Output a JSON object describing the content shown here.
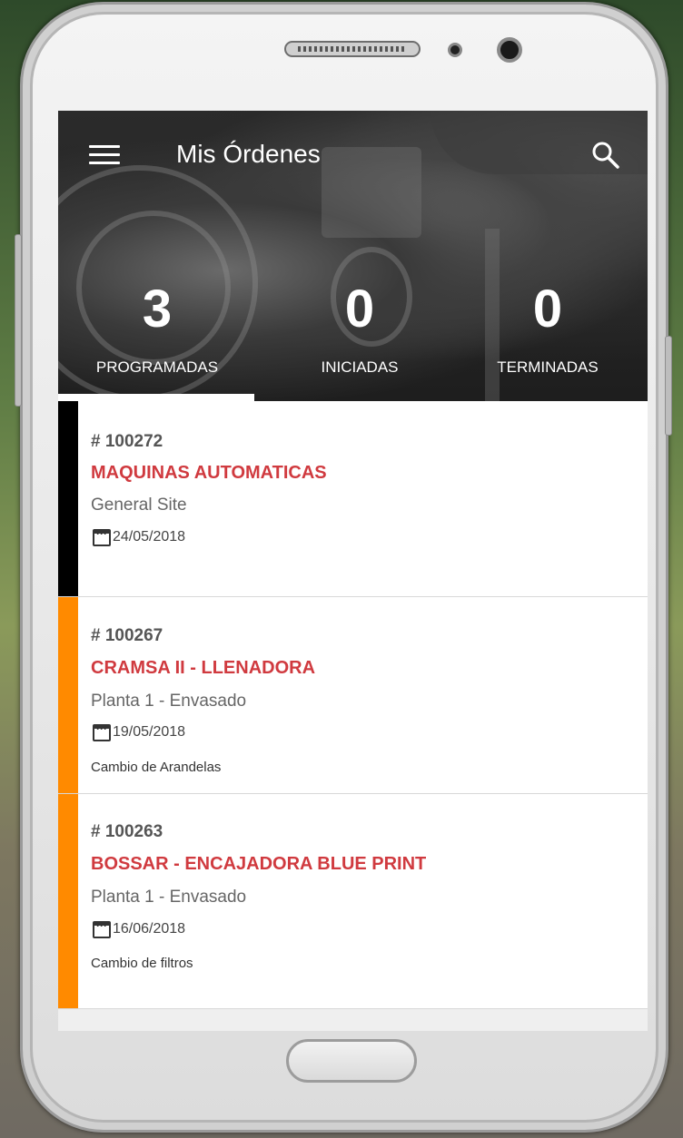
{
  "app": {
    "title": "Mis Órdenes"
  },
  "stats": [
    {
      "count": "3",
      "label": "PROGRAMADAS"
    },
    {
      "count": "0",
      "label": "INICIADAS"
    },
    {
      "count": "0",
      "label": "TERMINADAS"
    }
  ],
  "orders": [
    {
      "number": "# 100272",
      "name": "MAQUINAS AUTOMATICAS",
      "site": "General Site",
      "date": "24/05/2018",
      "description": "",
      "status_color": "#000000"
    },
    {
      "number": "# 100267",
      "name": "CRAMSA II - LLENADORA",
      "site": "Planta 1 - Envasado",
      "date": "19/05/2018",
      "description": "Cambio de Arandelas",
      "status_color": "#ff8a00"
    },
    {
      "number": "# 100263",
      "name": "BOSSAR - ENCAJADORA BLUE PRINT",
      "site": "Planta 1 - Envasado",
      "date": "16/06/2018",
      "description": "Cambio de filtros",
      "status_color": "#ff8a00"
    }
  ],
  "icons": {
    "menu": "menu-icon",
    "search": "search-icon",
    "calendar": "calendar-icon"
  },
  "colors": {
    "accent": "#d03a3f",
    "pending": "#ff8a00",
    "scheduled": "#000000"
  }
}
